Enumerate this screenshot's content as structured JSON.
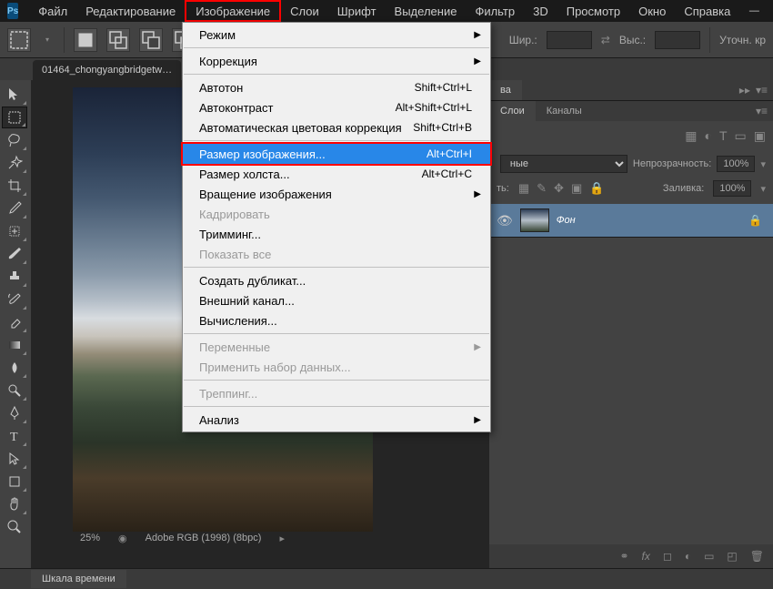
{
  "logo": "Ps",
  "menubar": [
    "Файл",
    "Редактирование",
    "Изображение",
    "Слои",
    "Шрифт",
    "Выделение",
    "Фильтр",
    "3D",
    "Просмотр",
    "Окно",
    "Справка"
  ],
  "menubar_highlighted_index": 2,
  "options_bar": {
    "width_label": "Шир.:",
    "height_label": "Выс.:",
    "refine_label": "Уточн. кр"
  },
  "doc_tab": "01464_chongyangbridgetw…",
  "status": {
    "zoom": "25%",
    "profile": "Adobe RGB (1998)  (8bpc)"
  },
  "timeline_tab": "Шкала времени",
  "right_panels": {
    "top_tab": "ва",
    "layers_tabs": [
      "Слои",
      "Каналы"
    ],
    "blend_mode": "ные",
    "opacity_label": "Непрозрачность:",
    "opacity_value": "100%",
    "lock_label": "ть:",
    "fill_label": "Заливка:",
    "fill_value": "100%",
    "layer_name": "Фон"
  },
  "dropdown": {
    "items": [
      {
        "label": "Режим",
        "arrow": true
      },
      {
        "sep": true
      },
      {
        "label": "Коррекция",
        "arrow": true
      },
      {
        "sep": true
      },
      {
        "label": "Автотон",
        "shortcut": "Shift+Ctrl+L"
      },
      {
        "label": "Автоконтраст",
        "shortcut": "Alt+Shift+Ctrl+L"
      },
      {
        "label": "Автоматическая цветовая коррекция",
        "shortcut": "Shift+Ctrl+B"
      },
      {
        "sep": true
      },
      {
        "label": "Размер изображения...",
        "shortcut": "Alt+Ctrl+I",
        "selected": true,
        "framed": true
      },
      {
        "label": "Размер холста...",
        "shortcut": "Alt+Ctrl+C"
      },
      {
        "label": "Вращение изображения",
        "arrow": true
      },
      {
        "label": "Кадрировать",
        "disabled": true
      },
      {
        "label": "Тримминг..."
      },
      {
        "label": "Показать все",
        "disabled": true
      },
      {
        "sep": true
      },
      {
        "label": "Создать дубликат..."
      },
      {
        "label": "Внешний канал..."
      },
      {
        "label": "Вычисления..."
      },
      {
        "sep": true
      },
      {
        "label": "Переменные",
        "arrow": true,
        "disabled": true
      },
      {
        "label": "Применить набор данных...",
        "disabled": true
      },
      {
        "sep": true
      },
      {
        "label": "Треппинг...",
        "disabled": true
      },
      {
        "sep": true
      },
      {
        "label": "Анализ",
        "arrow": true
      }
    ]
  }
}
